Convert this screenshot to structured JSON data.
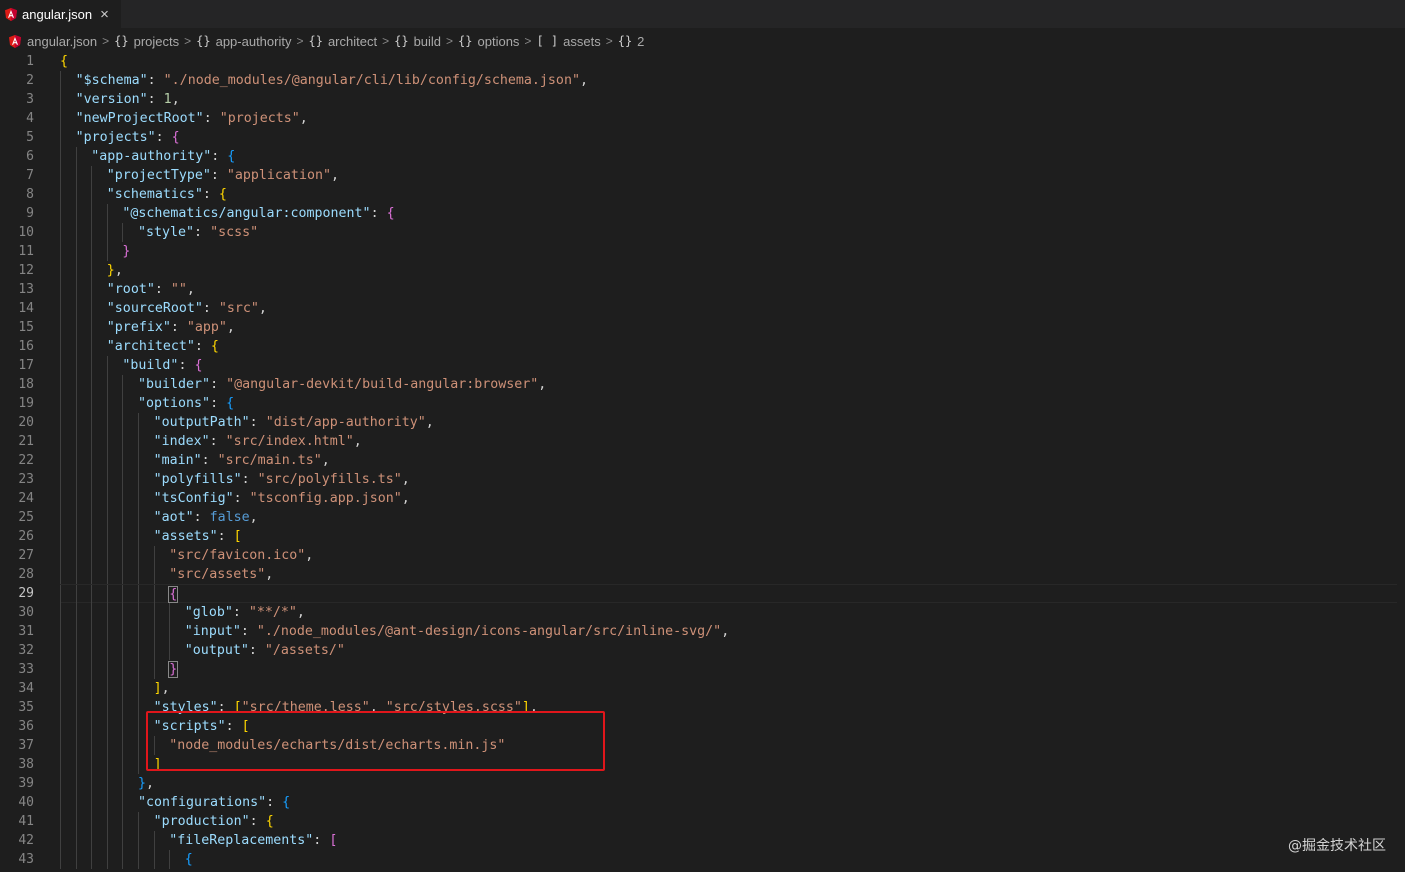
{
  "tab": {
    "icon": "angular-icon",
    "label": "angular.json",
    "close": "×"
  },
  "breadcrumb": [
    {
      "symbol": "angular-icon",
      "label": "angular.json"
    },
    {
      "symbol": "{}",
      "label": "projects"
    },
    {
      "symbol": "{}",
      "label": "app-authority"
    },
    {
      "symbol": "{}",
      "label": "architect"
    },
    {
      "symbol": "{}",
      "label": "build"
    },
    {
      "symbol": "{}",
      "label": "options"
    },
    {
      "symbol": "[ ]",
      "label": "assets"
    },
    {
      "symbol": "{}",
      "label": "2"
    }
  ],
  "breadcrumb_separator": ">",
  "editor": {
    "current_line": 29,
    "lines": [
      {
        "num": "1",
        "indent": 0,
        "tokens": [
          [
            "br1",
            "{"
          ]
        ]
      },
      {
        "num": "2",
        "indent": 1,
        "tokens": [
          [
            "k",
            "\"$schema\""
          ],
          [
            "p",
            ": "
          ],
          [
            "s",
            "\"./node_modules/@angular/cli/lib/config/schema.json\""
          ],
          [
            "p",
            ","
          ]
        ]
      },
      {
        "num": "3",
        "indent": 1,
        "tokens": [
          [
            "k",
            "\"version\""
          ],
          [
            "p",
            ": "
          ],
          [
            "n",
            "1"
          ],
          [
            "p",
            ","
          ]
        ]
      },
      {
        "num": "4",
        "indent": 1,
        "tokens": [
          [
            "k",
            "\"newProjectRoot\""
          ],
          [
            "p",
            ": "
          ],
          [
            "s",
            "\"projects\""
          ],
          [
            "p",
            ","
          ]
        ]
      },
      {
        "num": "5",
        "indent": 1,
        "tokens": [
          [
            "k",
            "\"projects\""
          ],
          [
            "p",
            ": "
          ],
          [
            "br2",
            "{"
          ]
        ]
      },
      {
        "num": "6",
        "indent": 2,
        "tokens": [
          [
            "k",
            "\"app-authority\""
          ],
          [
            "p",
            ": "
          ],
          [
            "br3",
            "{"
          ]
        ]
      },
      {
        "num": "7",
        "indent": 3,
        "tokens": [
          [
            "k",
            "\"projectType\""
          ],
          [
            "p",
            ": "
          ],
          [
            "s",
            "\"application\""
          ],
          [
            "p",
            ","
          ]
        ]
      },
      {
        "num": "8",
        "indent": 3,
        "tokens": [
          [
            "k",
            "\"schematics\""
          ],
          [
            "p",
            ": "
          ],
          [
            "br1",
            "{"
          ]
        ]
      },
      {
        "num": "9",
        "indent": 4,
        "tokens": [
          [
            "k",
            "\"@schematics/angular:component\""
          ],
          [
            "p",
            ": "
          ],
          [
            "br2",
            "{"
          ]
        ]
      },
      {
        "num": "10",
        "indent": 5,
        "tokens": [
          [
            "k",
            "\"style\""
          ],
          [
            "p",
            ": "
          ],
          [
            "s",
            "\"scss\""
          ]
        ]
      },
      {
        "num": "11",
        "indent": 4,
        "tokens": [
          [
            "br2",
            "}"
          ]
        ]
      },
      {
        "num": "12",
        "indent": 3,
        "tokens": [
          [
            "br1",
            "}"
          ],
          [
            "p",
            ","
          ]
        ]
      },
      {
        "num": "13",
        "indent": 3,
        "tokens": [
          [
            "k",
            "\"root\""
          ],
          [
            "p",
            ": "
          ],
          [
            "s",
            "\"\""
          ],
          [
            "p",
            ","
          ]
        ]
      },
      {
        "num": "14",
        "indent": 3,
        "tokens": [
          [
            "k",
            "\"sourceRoot\""
          ],
          [
            "p",
            ": "
          ],
          [
            "s",
            "\"src\""
          ],
          [
            "p",
            ","
          ]
        ]
      },
      {
        "num": "15",
        "indent": 3,
        "tokens": [
          [
            "k",
            "\"prefix\""
          ],
          [
            "p",
            ": "
          ],
          [
            "s",
            "\"app\""
          ],
          [
            "p",
            ","
          ]
        ]
      },
      {
        "num": "16",
        "indent": 3,
        "tokens": [
          [
            "k",
            "\"architect\""
          ],
          [
            "p",
            ": "
          ],
          [
            "br1",
            "{"
          ]
        ]
      },
      {
        "num": "17",
        "indent": 4,
        "tokens": [
          [
            "k",
            "\"build\""
          ],
          [
            "p",
            ": "
          ],
          [
            "br2",
            "{"
          ]
        ]
      },
      {
        "num": "18",
        "indent": 5,
        "tokens": [
          [
            "k",
            "\"builder\""
          ],
          [
            "p",
            ": "
          ],
          [
            "s",
            "\"@angular-devkit/build-angular:browser\""
          ],
          [
            "p",
            ","
          ]
        ]
      },
      {
        "num": "19",
        "indent": 5,
        "tokens": [
          [
            "k",
            "\"options\""
          ],
          [
            "p",
            ": "
          ],
          [
            "br3",
            "{"
          ]
        ]
      },
      {
        "num": "20",
        "indent": 6,
        "tokens": [
          [
            "k",
            "\"outputPath\""
          ],
          [
            "p",
            ": "
          ],
          [
            "s",
            "\"dist/app-authority\""
          ],
          [
            "p",
            ","
          ]
        ]
      },
      {
        "num": "21",
        "indent": 6,
        "tokens": [
          [
            "k",
            "\"index\""
          ],
          [
            "p",
            ": "
          ],
          [
            "s",
            "\"src/index.html\""
          ],
          [
            "p",
            ","
          ]
        ]
      },
      {
        "num": "22",
        "indent": 6,
        "tokens": [
          [
            "k",
            "\"main\""
          ],
          [
            "p",
            ": "
          ],
          [
            "s",
            "\"src/main.ts\""
          ],
          [
            "p",
            ","
          ]
        ]
      },
      {
        "num": "23",
        "indent": 6,
        "tokens": [
          [
            "k",
            "\"polyfills\""
          ],
          [
            "p",
            ": "
          ],
          [
            "s",
            "\"src/polyfills.ts\""
          ],
          [
            "p",
            ","
          ]
        ]
      },
      {
        "num": "24",
        "indent": 6,
        "tokens": [
          [
            "k",
            "\"tsConfig\""
          ],
          [
            "p",
            ": "
          ],
          [
            "s",
            "\"tsconfig.app.json\""
          ],
          [
            "p",
            ","
          ]
        ]
      },
      {
        "num": "25",
        "indent": 6,
        "tokens": [
          [
            "k",
            "\"aot\""
          ],
          [
            "p",
            ": "
          ],
          [
            "b",
            "false"
          ],
          [
            "p",
            ","
          ]
        ]
      },
      {
        "num": "26",
        "indent": 6,
        "tokens": [
          [
            "k",
            "\"assets\""
          ],
          [
            "p",
            ": "
          ],
          [
            "br1",
            "["
          ]
        ]
      },
      {
        "num": "27",
        "indent": 7,
        "tokens": [
          [
            "s",
            "\"src/favicon.ico\""
          ],
          [
            "p",
            ","
          ]
        ]
      },
      {
        "num": "28",
        "indent": 7,
        "tokens": [
          [
            "s",
            "\"src/assets\""
          ],
          [
            "p",
            ","
          ]
        ]
      },
      {
        "num": "29",
        "indent": 7,
        "tokens": [
          [
            "br2 bm",
            "{"
          ]
        ]
      },
      {
        "num": "30",
        "indent": 8,
        "tokens": [
          [
            "k",
            "\"glob\""
          ],
          [
            "p",
            ": "
          ],
          [
            "s",
            "\"**/*\""
          ],
          [
            "p",
            ","
          ]
        ]
      },
      {
        "num": "31",
        "indent": 8,
        "tokens": [
          [
            "k",
            "\"input\""
          ],
          [
            "p",
            ": "
          ],
          [
            "s",
            "\"./node_modules/@ant-design/icons-angular/src/inline-svg/\""
          ],
          [
            "p",
            ","
          ]
        ]
      },
      {
        "num": "32",
        "indent": 8,
        "tokens": [
          [
            "k",
            "\"output\""
          ],
          [
            "p",
            ": "
          ],
          [
            "s",
            "\"/assets/\""
          ]
        ]
      },
      {
        "num": "33",
        "indent": 7,
        "tokens": [
          [
            "br2 bm",
            "}"
          ]
        ]
      },
      {
        "num": "34",
        "indent": 6,
        "tokens": [
          [
            "br1",
            "]"
          ],
          [
            "p",
            ","
          ]
        ]
      },
      {
        "num": "35",
        "indent": 6,
        "tokens": [
          [
            "k",
            "\"styles\""
          ],
          [
            "p",
            ": "
          ],
          [
            "br1",
            "["
          ],
          [
            "s",
            "\"src/theme.less\""
          ],
          [
            "p",
            ", "
          ],
          [
            "s",
            "\"src/styles.scss\""
          ],
          [
            "br1",
            "]"
          ],
          [
            "p",
            ","
          ]
        ]
      },
      {
        "num": "36",
        "indent": 6,
        "tokens": [
          [
            "k",
            "\"scripts\""
          ],
          [
            "p",
            ": "
          ],
          [
            "br1",
            "["
          ]
        ]
      },
      {
        "num": "37",
        "indent": 7,
        "tokens": [
          [
            "s",
            "\"node_modules/echarts/dist/echarts.min.js\""
          ]
        ]
      },
      {
        "num": "38",
        "indent": 6,
        "tokens": [
          [
            "br1",
            "]"
          ]
        ]
      },
      {
        "num": "39",
        "indent": 5,
        "tokens": [
          [
            "br3",
            "}"
          ],
          [
            "p",
            ","
          ]
        ]
      },
      {
        "num": "40",
        "indent": 5,
        "tokens": [
          [
            "k",
            "\"configurations\""
          ],
          [
            "p",
            ": "
          ],
          [
            "br3",
            "{"
          ]
        ]
      },
      {
        "num": "41",
        "indent": 6,
        "tokens": [
          [
            "k",
            "\"production\""
          ],
          [
            "p",
            ": "
          ],
          [
            "br1",
            "{"
          ]
        ]
      },
      {
        "num": "42",
        "indent": 7,
        "tokens": [
          [
            "k",
            "\"fileReplacements\""
          ],
          [
            "p",
            ": "
          ],
          [
            "br2",
            "["
          ]
        ]
      },
      {
        "num": "43",
        "indent": 8,
        "tokens": [
          [
            "br3",
            "{"
          ]
        ]
      }
    ]
  },
  "watermark": "@掘金技术社区",
  "colors": {
    "background": "#1e1e1e",
    "key": "#9cdcfe",
    "string": "#ce9178",
    "number": "#b5cea8",
    "boolean": "#569cd6",
    "highlight_box": "#e0161b"
  }
}
